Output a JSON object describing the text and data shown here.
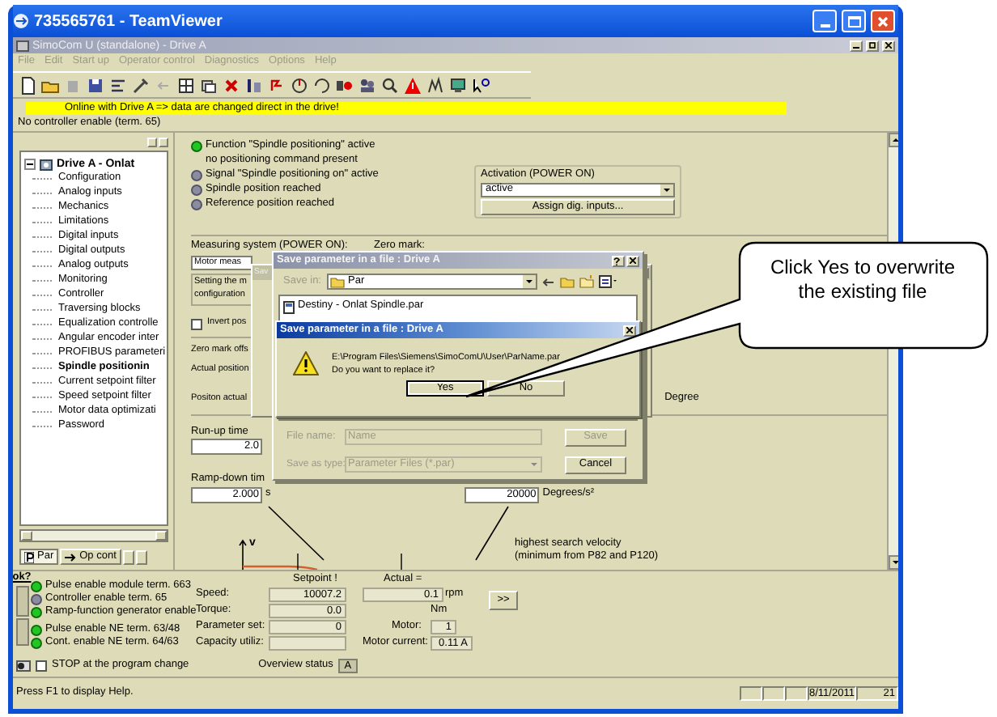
{
  "window": {
    "title": "735565761 - TeamViewer"
  },
  "app": {
    "title": "SimoCom U (standalone) - Drive A",
    "menu": [
      "File",
      "Edit",
      "Start up",
      "Operator control",
      "Diagnostics",
      "Options",
      "Help"
    ]
  },
  "online_banner": "Online with Drive A => data are changed direct in the drive!",
  "controller_status": "No controller enable (term. 65)",
  "tree": {
    "label": "Drive A - Onlat",
    "expanded": true,
    "children": [
      {
        "label": "Configuration",
        "selected": false
      },
      {
        "label": "Analog inputs",
        "selected": false
      },
      {
        "label": "Mechanics",
        "selected": false
      },
      {
        "label": "Limitations",
        "selected": false
      },
      {
        "label": "Digital inputs",
        "selected": false
      },
      {
        "label": "Digital outputs",
        "selected": false
      },
      {
        "label": "Analog outputs",
        "selected": false
      },
      {
        "label": "Monitoring",
        "selected": false
      },
      {
        "label": "Controller",
        "selected": false
      },
      {
        "label": "Traversing blocks",
        "selected": false
      },
      {
        "label": "Equalization controlle",
        "selected": false
      },
      {
        "label": "Angular encoder inter",
        "selected": false
      },
      {
        "label": "PROFIBUS parameteri",
        "selected": false
      },
      {
        "label": "Spindle positionin",
        "selected": true
      },
      {
        "label": "Current setpoint filter",
        "selected": false
      },
      {
        "label": "Speed setpoint filter",
        "selected": false
      },
      {
        "label": "Motor data optimizati",
        "selected": false
      },
      {
        "label": "Password",
        "selected": false
      }
    ]
  },
  "left_tabs": [
    {
      "label": "Par",
      "selected": true
    },
    {
      "label": "Op cont",
      "selected": false
    }
  ],
  "spindle_status": [
    {
      "text": "Function \"Spindle positioning\" active",
      "detail": "no positioning command present",
      "on": true
    },
    {
      "text": "Signal \"Spindle positioning on\" active",
      "on": false
    },
    {
      "text": "Spindle position reached",
      "on": false
    },
    {
      "text": "Reference position reached",
      "on": false
    }
  ],
  "activation": {
    "label": "Activation (POWER ON)",
    "value": "active",
    "button": "Assign dig. inputs..."
  },
  "measuring": {
    "label": "Measuring system (POWER ON):",
    "zero_mark_label": "Zero mark:",
    "combo_value": "Motor meas",
    "info_lines": [
      "Setting the m",
      "configuration"
    ],
    "invert_label": "Invert pos",
    "invert_checked": false,
    "zero_mark_offset_label": "Zero mark offs",
    "actual_position_label": "Actual position",
    "position_actual_label": "Positon actual",
    "degree_unit": "Degree"
  },
  "ramp": {
    "run_up_label": "Run-up time",
    "run_up_value": "2.0",
    "ramp_down_label": "Ramp-down tim",
    "ramp_down_value": "2.000",
    "unit": "s",
    "accel_value": "20000",
    "accel_unit": "Degrees/s²"
  },
  "graph_axis_label": "v",
  "search_velocity_note": [
    "highest search velocity",
    "(minimum from P82 and P120)"
  ],
  "back_dialog": {
    "title": "Sav"
  },
  "save_dialog": {
    "title": "Save parameter in a file : Drive A",
    "save_in_label": "Save in:",
    "folder": "Par",
    "files": [
      "Destiny - Onlat Spindle.par"
    ],
    "file_name_label": "File name:",
    "file_name": "Name",
    "type_label": "Save as type:",
    "type_value": "Parameter Files (*.par)",
    "save_button": "Save",
    "cancel_button": "Cancel"
  },
  "message_box": {
    "title": "Save parameter in a file : Drive A",
    "lines": [
      "E:\\Program Files\\Siemens\\SimoComU\\User\\ParName.par",
      "Do you want to replace it?"
    ],
    "buttons": [
      "Yes",
      "No"
    ]
  },
  "callout": "Click Yes to overwrite the existing file",
  "help_button": "ok?",
  "enable_status": [
    {
      "text": "Pulse enable module term. 663",
      "on": true
    },
    {
      "text": "Controller enable term. 65",
      "on": false
    },
    {
      "text": "Ramp-function generator enable",
      "on": true
    },
    {
      "text": "Pulse enable NE term. 63/48",
      "on": true
    },
    {
      "text": "Cont. enable NE term. 64/63",
      "on": true
    }
  ],
  "monitor": {
    "setpoint_header": "Setpoint !",
    "actual_header": "Actual =",
    "speed_label": "Speed:",
    "speed_setpoint": "10007.2",
    "speed_actual": "0.1",
    "speed_unit": "rpm",
    "torque_label": "Torque:",
    "torque_setpoint": "0.0",
    "torque_unit": "Nm",
    "param_set_label": "Parameter set:",
    "param_set": "0",
    "motor_label": "Motor:",
    "motor": "1",
    "capacity_label": "Capacity utiliz:",
    "motor_current_label": "Motor current:",
    "motor_current": "0.11 A",
    "more_button": ">>"
  },
  "stop_option": {
    "label": "STOP at the program change",
    "checked": false
  },
  "overview": {
    "label": "Overview status",
    "value": "A"
  },
  "status_bar": {
    "help": "Press F1 to display Help.",
    "date": "8/11/2011",
    "time": "21"
  }
}
